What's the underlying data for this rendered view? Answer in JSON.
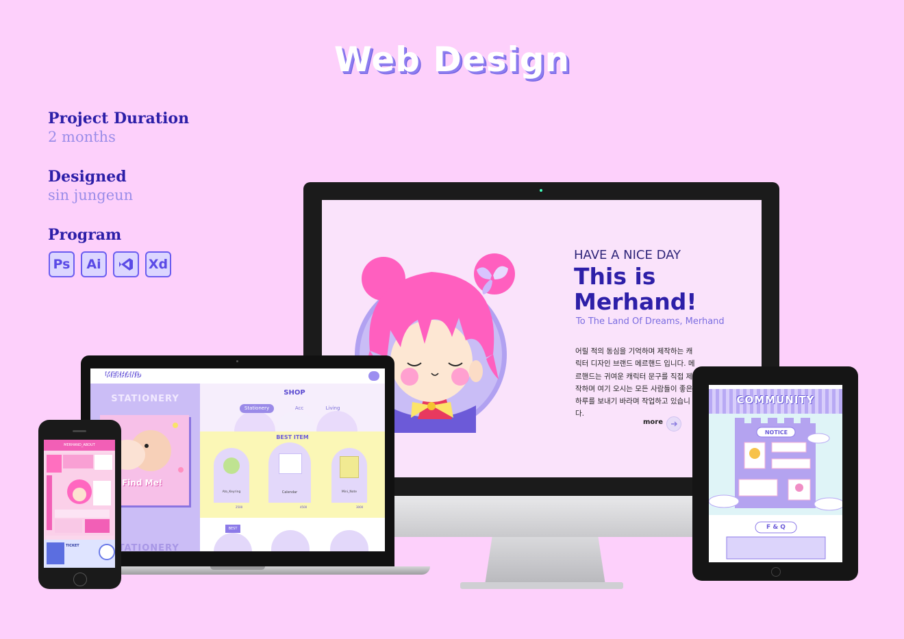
{
  "header": {
    "title": "Web Design"
  },
  "info": {
    "duration_label": "Project Duration",
    "duration_value": "2 months",
    "designer_label": "Designed",
    "designer_value": "sin jungeun",
    "program_label": "Program",
    "programs": [
      "Ps",
      "Ai",
      "Xd"
    ]
  },
  "desktop": {
    "subtitle": "HAVE A NICE DAY",
    "title": "This is Merhand!",
    "tagline": "To The Land Of Dreams, Merhand",
    "body": "어릴 적의 동심을 기억하며 제작하는 캐릭터 디자인 브랜드 메르핸드 입니다. 메르핸드는 귀여운 캐릭터 문구를 직접 제작하며 여기 오시는 모든 사람들이 좋은 하루를 보내기 바라며 작업하고 있습니다.",
    "more": "more"
  },
  "laptop": {
    "logo": "MERHAND",
    "side_title": "STATIONERY",
    "side_title_bottom": "STATIONERY",
    "card_text": "Find Me!",
    "shop": "SHOP",
    "tabs": [
      "Stationery",
      "Acc",
      "Living"
    ],
    "best_item": "BEST ITEM",
    "products": [
      {
        "name": "Ato_Keyring",
        "price": "2500"
      },
      {
        "name": "Calendar",
        "price": "4500"
      },
      {
        "name": "Mini_Note",
        "price": "3000"
      }
    ],
    "best_badge": "BEST"
  },
  "phone": {
    "header": "MERHAND_ABOUT",
    "ticket": "TICKET"
  },
  "tablet": {
    "title": "COMMUNITY",
    "notice": "NOTICE",
    "faq": "F & Q"
  },
  "colors": {
    "background": "#fdd0fb",
    "accent": "#2d1fa8",
    "lavender": "#b7a6f5",
    "pink": "#ff5fbf",
    "yellow": "#fbf7b6"
  }
}
